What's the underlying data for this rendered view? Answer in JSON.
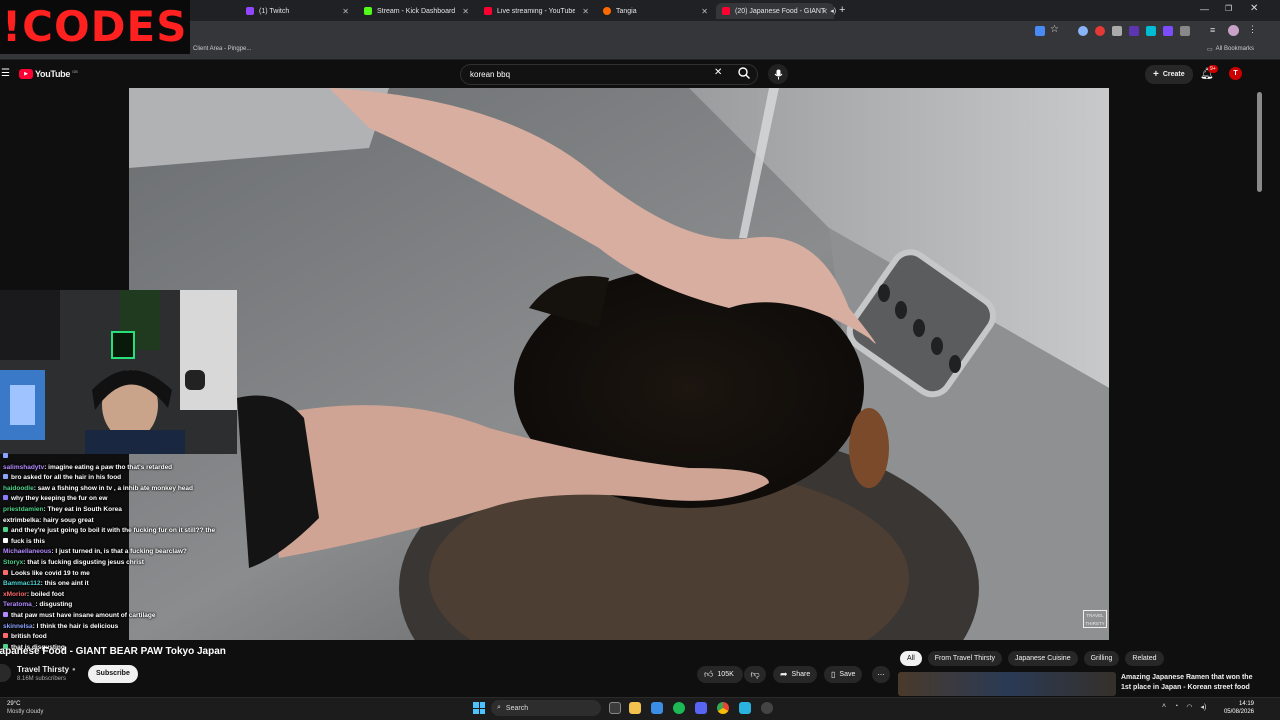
{
  "overlay": {
    "logo_text": "!CODES"
  },
  "browser": {
    "tabs": [
      {
        "label": "(1) Twitch",
        "color": "#9146ff"
      },
      {
        "label": "Stream - Kick Dashboard",
        "color": "#53fc18"
      },
      {
        "label": "Live streaming - YouTube Studio",
        "color": "#ff0033"
      },
      {
        "label": "Tangia",
        "color": "#ff6a00"
      },
      {
        "label": "(20) Japanese Food - GIANT",
        "color": "#ff0033"
      }
    ],
    "bookmark": "Client Area - Pingpe...",
    "all_bookmarks": "All Bookmarks"
  },
  "youtube": {
    "logo": "YouTube",
    "logo_region": "GB",
    "search_query": "korean bbq",
    "create_label": "Create",
    "notif_badge": "9+",
    "avatar_letter": "T",
    "video_title": "Japanese Food - GIANT BEAR PAW Tokyo Japan",
    "channel": "Travel Thirsty",
    "subscribers": "8.16M subscribers",
    "subscribe_label": "Subscribe",
    "likes": "105K",
    "share_label": "Share",
    "save_label": "Save",
    "watermark": "TRAVEL THIRSTY",
    "chips": [
      "All",
      "From Travel Thirsty",
      "Japanese Cuisine",
      "Grilling",
      "Related"
    ],
    "related_title": "Amazing Japanese Ramen that won the 1st place in Japan  - Korean street food"
  },
  "chat": [
    {
      "user": "",
      "msg": "",
      "color": "#8aa4ff"
    },
    {
      "user": "salimshadytv",
      "msg": "imagine eating a paw tho that's retarded",
      "color": "#b38aff"
    },
    {
      "user": "",
      "msg": "bro asked for all the hair in his food",
      "color": "#8aa4ff"
    },
    {
      "user": "haidoodle",
      "msg": "saw a fishing show in tv , a inhib ate monkey head",
      "color": "#4fd28a"
    },
    {
      "user": "",
      "msg": "why they keeping the fur on ew",
      "color": "#8a7bff"
    },
    {
      "user": "priestdamien",
      "msg": "They eat    in South Korea",
      "color": "#4fd28a"
    },
    {
      "user": "extrimbelka",
      "msg": "hairy soup great",
      "color": "#ffffff"
    },
    {
      "user": "",
      "msg": "and they're just going to boil it with the fucking fur on it still?? the",
      "color": "#4fd28a"
    },
    {
      "user": "",
      "msg": "fuck is this",
      "color": "#ffffff"
    },
    {
      "user": "Michaellaneous",
      "msg": "I just turned in, is that a fucking bearclaw?",
      "color": "#b38aff"
    },
    {
      "user": "Storyx",
      "msg": "that is fucking disgusting jesus christ",
      "color": "#4fd28a"
    },
    {
      "user": "",
      "msg": "Looks like covid 19 to me",
      "color": "#ff6b6b"
    },
    {
      "user": "Bammac112",
      "msg": "this one aint it",
      "color": "#4fd2d2"
    },
    {
      "user": "xMorior",
      "msg": "boiled       foot",
      "color": "#ff6b6b"
    },
    {
      "user": "Teratoma_",
      "msg": "disgusting",
      "color": "#b38aff"
    },
    {
      "user": "",
      "msg": "that paw must have insane amount of cartilage",
      "color": "#b38aff"
    },
    {
      "user": "skinnelsa",
      "msg": "I think the hair is delicious",
      "color": "#8aa4ff"
    },
    {
      "user": "",
      "msg": "british food",
      "color": "#ff6b6b"
    },
    {
      "user": "",
      "msg": "that is disgusting",
      "color": "#4fd28a"
    }
  ],
  "taskbar": {
    "weather_temp": "29°C",
    "weather_desc": "Mostly cloudy",
    "search_label": "Search",
    "time": "14:19",
    "date": "05/08/2026"
  }
}
